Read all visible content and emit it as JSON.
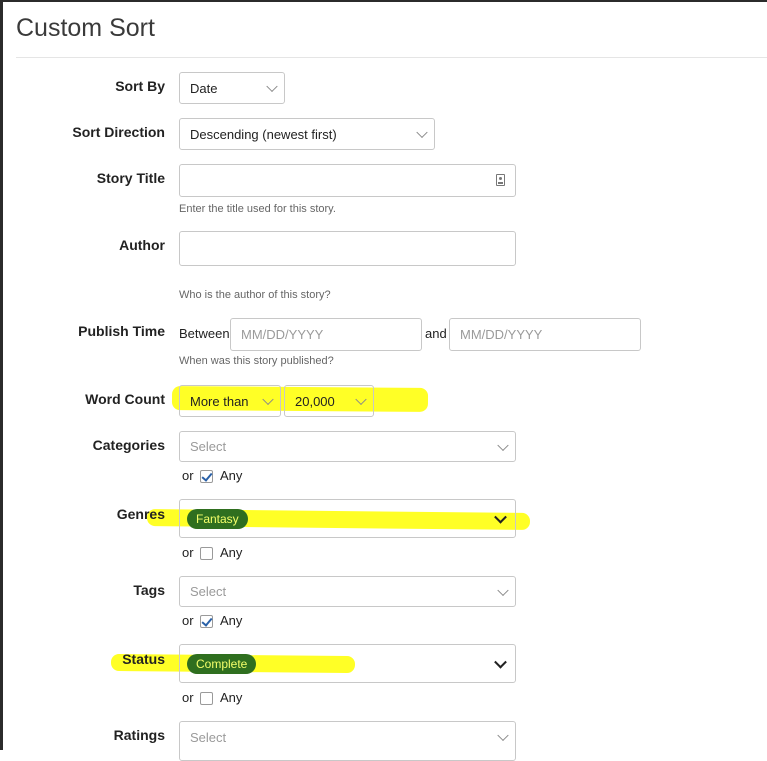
{
  "title": "Custom Sort",
  "sort_by": {
    "label": "Sort By",
    "value": "Date"
  },
  "sort_direction": {
    "label": "Sort Direction",
    "value": "Descending (newest first)"
  },
  "story_title": {
    "label": "Story Title",
    "value": "",
    "help": "Enter the title used for this story."
  },
  "author": {
    "label": "Author",
    "value": "",
    "help": "Who is the author of this story?"
  },
  "publish_time": {
    "label": "Publish Time",
    "between": "Between",
    "and": "and",
    "from_placeholder": "MM/DD/YYYY",
    "to_placeholder": "MM/DD/YYYY",
    "help": "When was this story published?"
  },
  "word_count": {
    "label": "Word Count",
    "comparator": "More than",
    "amount": "20,000"
  },
  "categories": {
    "label": "Categories",
    "placeholder": "Select",
    "or": "or",
    "any": "Any",
    "any_checked": true
  },
  "genres": {
    "label": "Genres",
    "selected": "Fantasy",
    "or": "or",
    "any": "Any",
    "any_checked": false
  },
  "tags": {
    "label": "Tags",
    "placeholder": "Select",
    "or": "or",
    "any": "Any",
    "any_checked": true
  },
  "status": {
    "label": "Status",
    "selected": "Complete",
    "or": "or",
    "any": "Any",
    "any_checked": false
  },
  "ratings": {
    "label": "Ratings",
    "placeholder": "Select"
  },
  "colors": {
    "highlight": "#ffff00",
    "chip_bg": "#2f6f1f",
    "chip_text": "#f4ff6a",
    "check": "#2a61a8"
  }
}
